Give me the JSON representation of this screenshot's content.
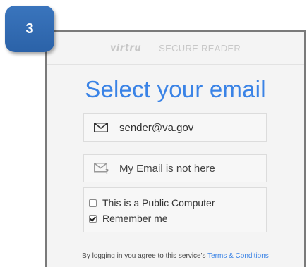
{
  "step": {
    "number": "3",
    "color": "#2f6db3"
  },
  "header": {
    "brand": "virtru",
    "subtitle": "SECURE READER"
  },
  "main": {
    "title": "Select your email",
    "title_color": "#3a83e6",
    "options": [
      {
        "label": "sender@va.gov",
        "icon": "envelope-icon"
      },
      {
        "label": "My Email is not here",
        "icon": "envelope-question-icon"
      }
    ],
    "checkboxes": [
      {
        "label": "This is a Public Computer",
        "checked": false
      },
      {
        "label": "Remember me",
        "checked": true
      }
    ]
  },
  "footer": {
    "text": "By logging in you agree to this service's ",
    "link": "Terms & Conditions",
    "link_color": "#3a83e6"
  }
}
